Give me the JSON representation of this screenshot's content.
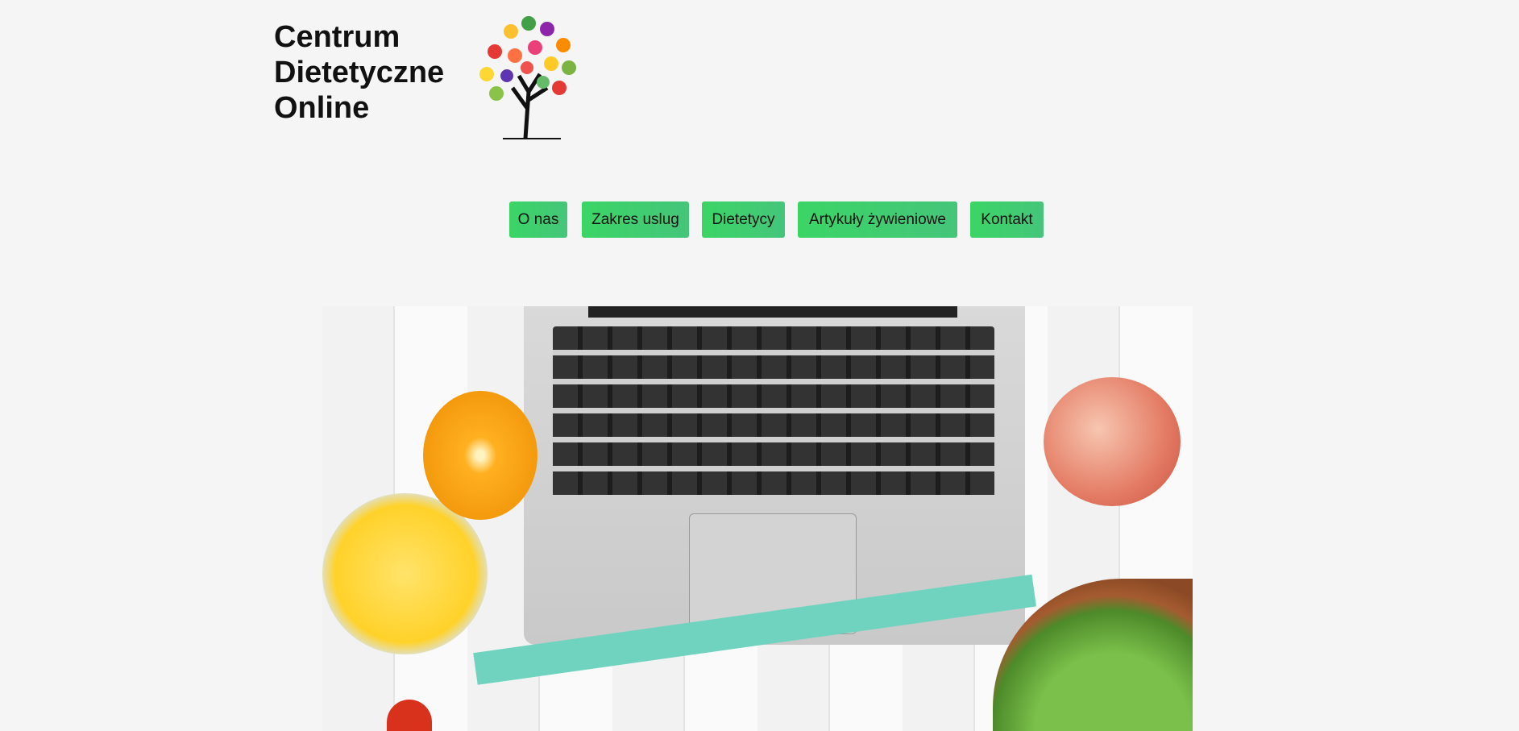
{
  "header": {
    "title_lines": [
      "Centrum",
      "Dietetyczne",
      "Online"
    ],
    "logo": "fruit-tree-logo"
  },
  "nav": {
    "items": [
      {
        "label": "O nas"
      },
      {
        "label": "Zakres uslug"
      },
      {
        "label": "Dietetycy"
      },
      {
        "label": "Artykuły żywieniowe"
      },
      {
        "label": "Kontakt"
      }
    ]
  },
  "colors": {
    "button": "#3bd566",
    "background": "#f5f5f5"
  }
}
